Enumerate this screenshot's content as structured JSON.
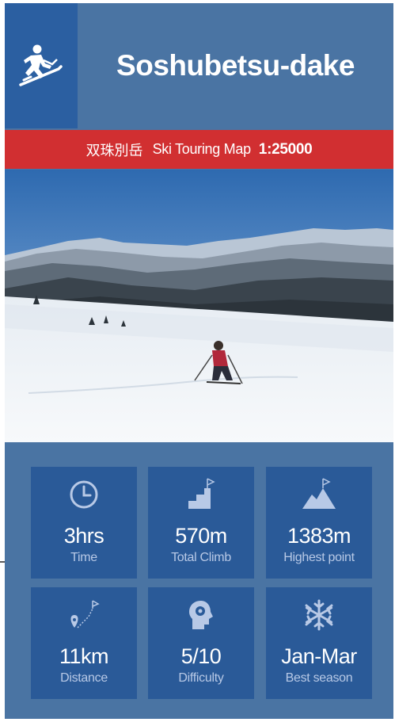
{
  "header": {
    "title": "Soshubetsu-dake",
    "logo_icon": "ski-touring-icon"
  },
  "banner": {
    "kanji": "双珠別岳",
    "map_name": "Ski Touring Map",
    "scale": "1:25000",
    "color": "#d12f31"
  },
  "photo": {
    "icon": "skier-photo"
  },
  "stats": [
    {
      "icon": "clock-icon",
      "value": "3hrs",
      "label": "Time"
    },
    {
      "icon": "stairs-flag-icon",
      "value": "570m",
      "label": "Total Climb"
    },
    {
      "icon": "mountain-flag-icon",
      "value": "1383m",
      "label": "Highest point"
    },
    {
      "icon": "route-pin-icon",
      "value": "11km",
      "label": "Distance"
    },
    {
      "icon": "brain-gear-icon",
      "value": "5/10",
      "label": "Difficulty"
    },
    {
      "icon": "snowflake-icon",
      "value": "Jan-Mar",
      "label": "Best season"
    }
  ],
  "colors": {
    "background": "#4a74a3",
    "tile": "#2a5a98",
    "logo_box": "#2b5fa1",
    "label": "#b8c9e6"
  }
}
